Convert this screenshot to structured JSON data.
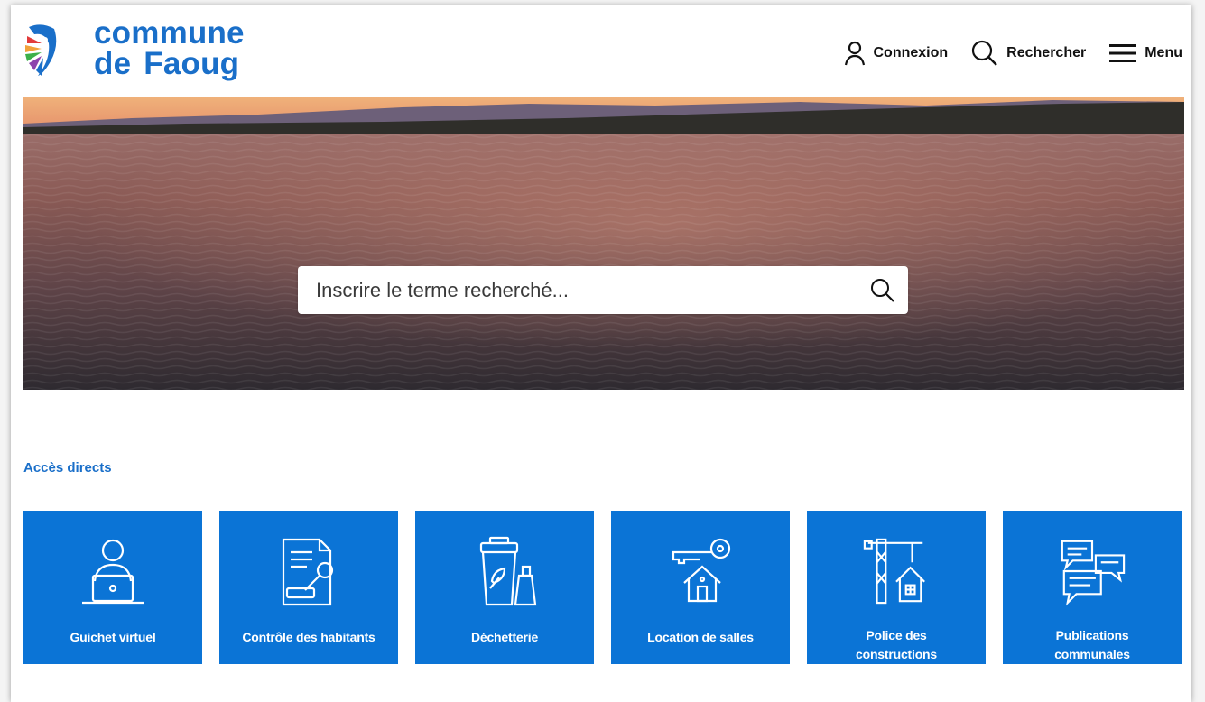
{
  "header": {
    "logo_line1": "commune",
    "logo_line2_a": "de",
    "logo_line2_b": "Faoug",
    "nav": {
      "login_label": "Connexion",
      "search_label": "Rechercher",
      "menu_label": "Menu"
    }
  },
  "hero": {
    "search_placeholder": "Inscrire le terme recherché..."
  },
  "quick_access": {
    "title": "Accès directs",
    "tiles": [
      {
        "label": "Guichet virtuel",
        "icon": "laptop-user-icon"
      },
      {
        "label": "Contrôle des habitants",
        "icon": "document-stamp-icon"
      },
      {
        "label": "Déchetterie",
        "icon": "recycling-bin-icon"
      },
      {
        "label": "Location de salles",
        "icon": "house-key-icon"
      },
      {
        "label": "Police des constructions",
        "icon": "crane-house-icon"
      },
      {
        "label": "Publications communales",
        "icon": "speech-bubbles-icon"
      }
    ]
  },
  "colors": {
    "brand_blue": "#1a6fc9",
    "tile_blue": "#0b74d6"
  }
}
